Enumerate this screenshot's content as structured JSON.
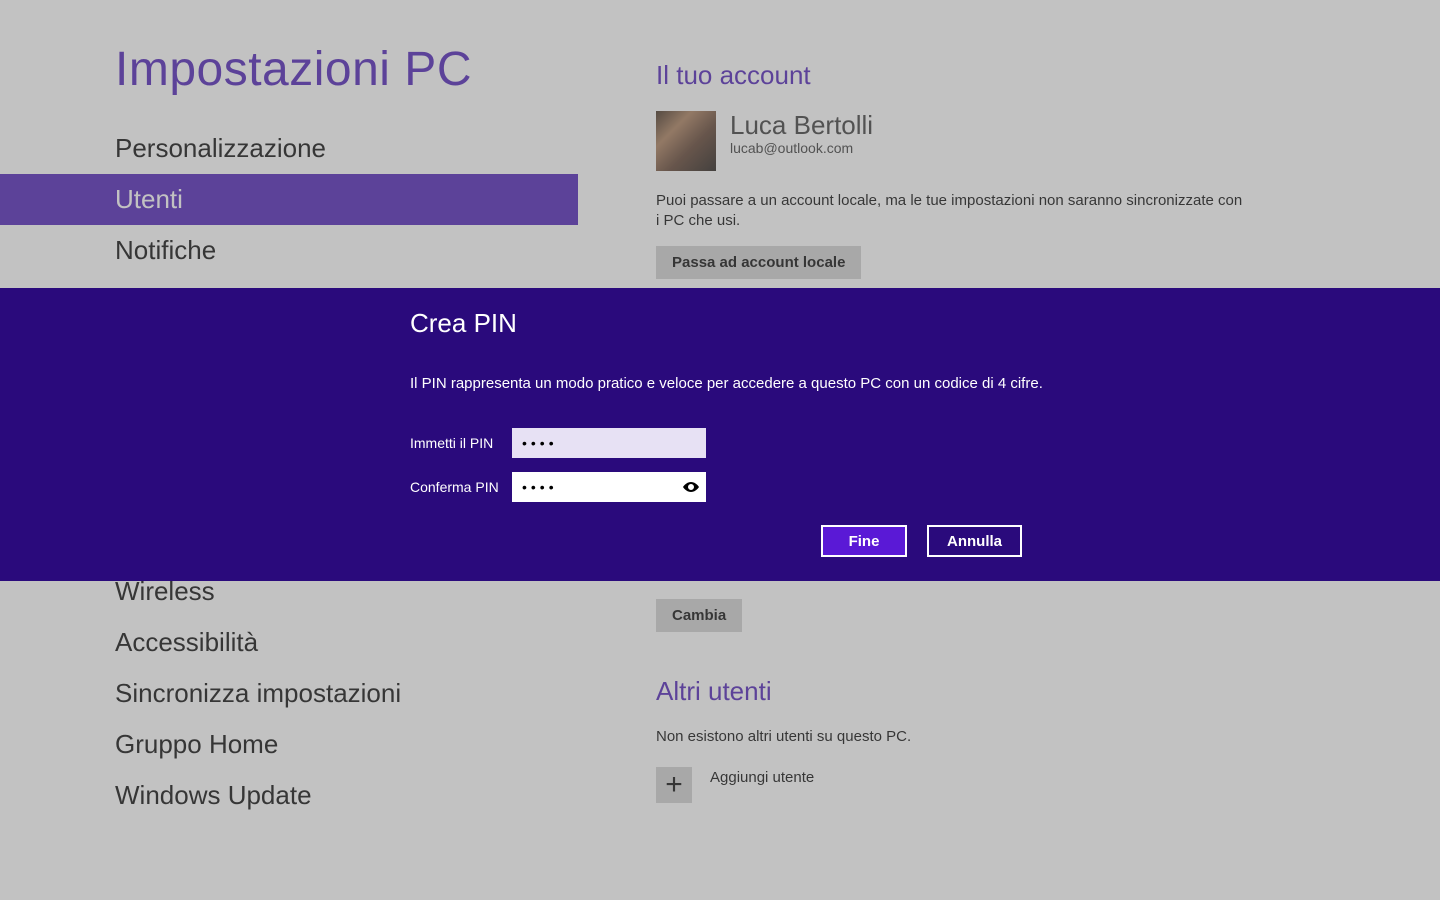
{
  "colors": {
    "accent": "#4617b4",
    "modal_bg": "#2a0a7c",
    "primary_button": "#5a19d6"
  },
  "sidebar": {
    "app_title": "Impostazioni PC",
    "items": [
      {
        "label": "Personalizzazione",
        "selected": false
      },
      {
        "label": "Utenti",
        "selected": true
      },
      {
        "label": "Notifiche",
        "selected": false
      },
      {
        "label": "Wireless",
        "selected": false
      },
      {
        "label": "Accessibilità",
        "selected": false
      },
      {
        "label": "Sincronizza impostazioni",
        "selected": false
      },
      {
        "label": "Gruppo Home",
        "selected": false
      },
      {
        "label": "Windows Update",
        "selected": false
      }
    ]
  },
  "main": {
    "account_section": {
      "heading": "Il tuo account",
      "user_name": "Luca Bertolli",
      "user_email": "lucab@outlook.com",
      "description": "Puoi passare a un account locale, ma le tue impostazioni non saranno sincronizzate con i PC che usi.",
      "switch_button": "Passa ad account locale"
    },
    "change_button": "Cambia",
    "other_users": {
      "heading": "Altri utenti",
      "empty_text": "Non esistono altri utenti su questo PC.",
      "add_icon": "+",
      "add_label": "Aggiungi utente"
    }
  },
  "modal": {
    "title": "Crea PIN",
    "description": "Il PIN rappresenta un modo pratico e veloce per accedere a questo PC con un codice di 4 cifre.",
    "field1_label": "Immetti il PIN",
    "field1_value": "••••",
    "field2_label": "Conferma PIN",
    "field2_value": "••••",
    "primary_button": "Fine",
    "secondary_button": "Annulla"
  }
}
